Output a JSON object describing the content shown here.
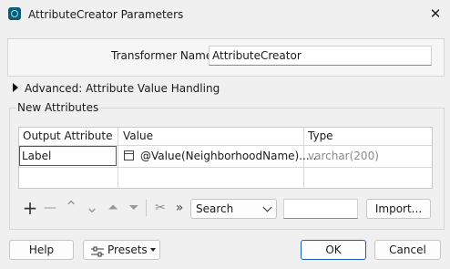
{
  "window": {
    "title": "AttributeCreator Parameters",
    "close_glyph": "✕"
  },
  "transformer": {
    "label": "Transformer Name:",
    "value": "AttributeCreator"
  },
  "advanced": {
    "label": "Advanced: Attribute Value Handling"
  },
  "new_attributes": {
    "group_label": "New Attributes",
    "columns": [
      "Output Attribute",
      "Value",
      "Type"
    ],
    "rows": [
      {
        "output": "Label",
        "value": "@Value(NeighborhoodName).....",
        "type": "varchar(200)"
      }
    ]
  },
  "toolbar": {
    "add_glyph": "+",
    "remove_glyph": "—",
    "up_glyph": "⌃",
    "down_glyph": "⌄",
    "top_glyph": "⏶",
    "bottom_glyph": "⏷",
    "cut_glyph": "✂",
    "more_glyph": "»",
    "search_value": "Search",
    "import_label": "Import..."
  },
  "footer": {
    "help_label": "Help",
    "presets_label": "Presets",
    "ok_label": "OK",
    "cancel_label": "Cancel"
  }
}
